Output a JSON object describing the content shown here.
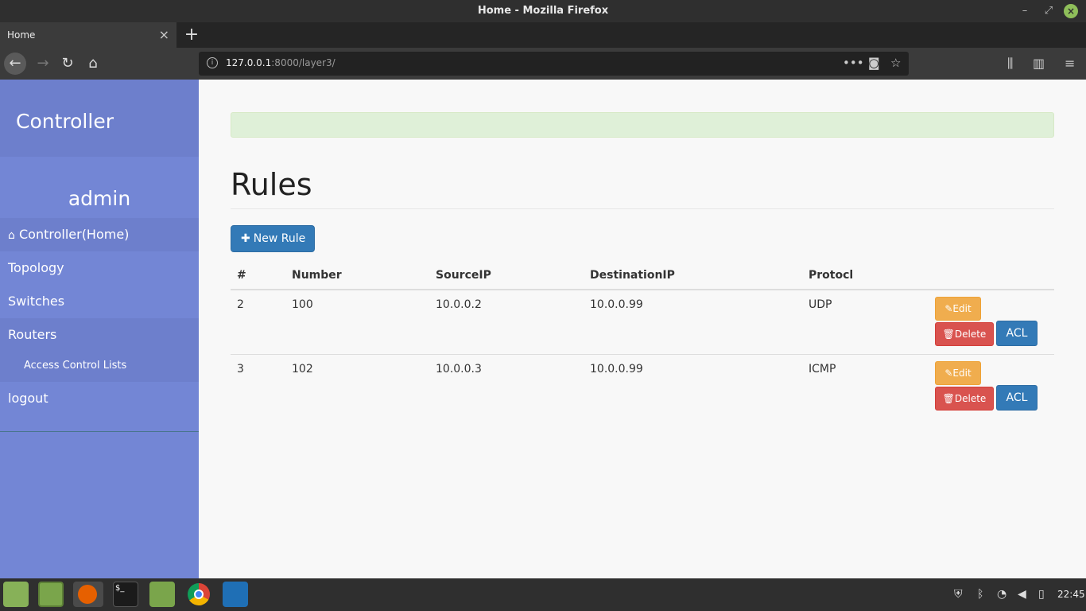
{
  "window": {
    "title": "Home - Mozilla Firefox",
    "minimize": "–",
    "maximize": "⤢",
    "close": "×"
  },
  "browser": {
    "tab_title": "Home",
    "tab_close": "×",
    "new_tab": "+",
    "url_host": "127.0.0.1",
    "url_rest": ":8000/layer3/",
    "icons": [
      "back-icon",
      "forward-icon",
      "reload-icon",
      "home-icon",
      "page-actions-icon",
      "pocket-icon",
      "bookmark-star-icon",
      "library-icon",
      "sidebar-icon",
      "menu-icon"
    ]
  },
  "sidebar": {
    "brand": "Controller",
    "user": "admin",
    "items": [
      {
        "label": "Controller(Home)"
      },
      {
        "label": "Topology"
      },
      {
        "label": "Switches"
      },
      {
        "label": "Routers"
      },
      {
        "label": "Access Control Lists"
      },
      {
        "label": "logout"
      }
    ]
  },
  "main": {
    "title": "Rules",
    "new_button": "New Rule",
    "table": {
      "headers": [
        "#",
        "Number",
        "SourceIP",
        "DestinationIP",
        "Protocl",
        ""
      ],
      "rows": [
        {
          "id": "2",
          "number": "100",
          "source": "10.0.0.2",
          "dest": "10.0.0.99",
          "protocol": "UDP",
          "edit": "Edit",
          "delete": "Delete",
          "acl": "ACL"
        },
        {
          "id": "3",
          "number": "102",
          "source": "10.0.0.3",
          "dest": "10.0.0.99",
          "protocol": "ICMP",
          "edit": "Edit",
          "delete": "Delete",
          "acl": "ACL"
        }
      ]
    }
  },
  "taskbar": {
    "apps": [
      "mint-menu-icon",
      "show-desktop-icon",
      "firefox-icon",
      "terminal-icon",
      "files-icon",
      "chrome-icon",
      "vscode-icon"
    ],
    "clock": "22:45"
  },
  "colors": {
    "sidebar": "#7386d5",
    "sidebar_dark": "#6d7fcc",
    "primary": "#337ab7",
    "warning": "#f0ad4e",
    "danger": "#d9534f",
    "success_bg": "#dff0d8"
  }
}
